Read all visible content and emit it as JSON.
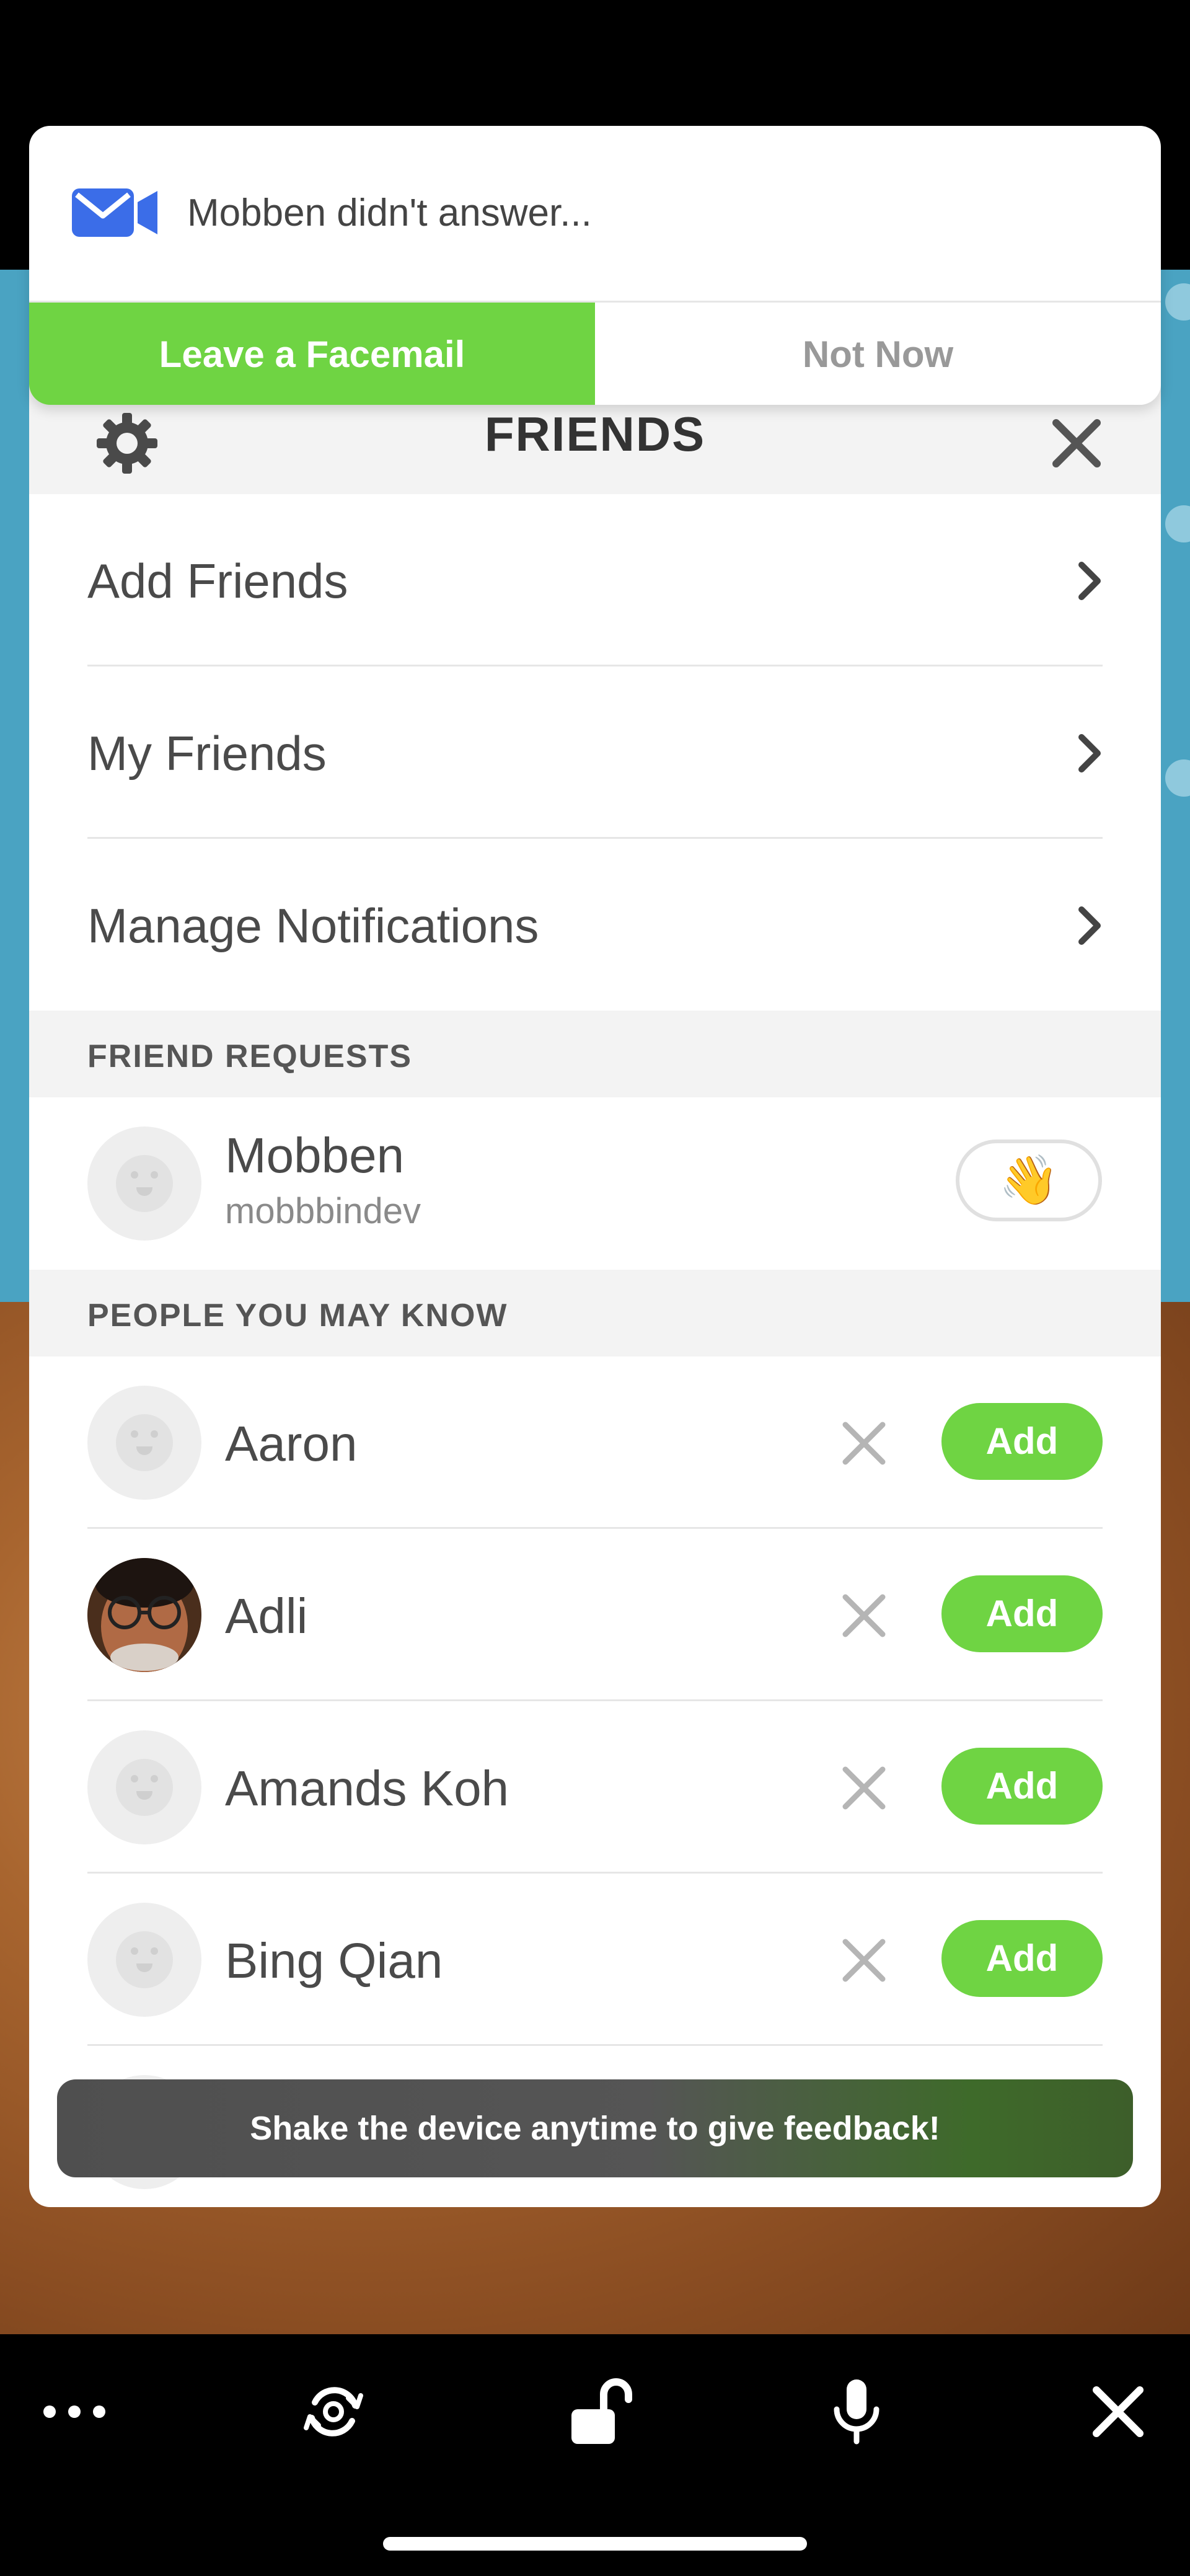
{
  "notification": {
    "message": "Mobben didn't answer...",
    "primary_label": "Leave a Facemail",
    "secondary_label": "Not Now"
  },
  "panel": {
    "title": "FRIENDS"
  },
  "menu": [
    {
      "label": "Add Friends"
    },
    {
      "label": "My Friends"
    },
    {
      "label": "Manage Notifications"
    }
  ],
  "friend_requests": {
    "header": "FRIEND REQUESTS",
    "items": [
      {
        "name": "Mobben",
        "username": "mobbbindev",
        "action": "👋"
      }
    ]
  },
  "people_you_may_know": {
    "header": "PEOPLE YOU MAY KNOW",
    "add_label": "Add",
    "items": [
      {
        "name": "Aaron",
        "avatar": "placeholder"
      },
      {
        "name": "Adli",
        "avatar": "photo"
      },
      {
        "name": "Amands Koh",
        "avatar": "placeholder"
      },
      {
        "name": "Bing Qian",
        "avatar": "placeholder"
      }
    ]
  },
  "toast": {
    "message": "Shake the device anytime to give feedback!"
  },
  "controls": {
    "icons": [
      "more-icon",
      "flip-camera-icon",
      "unlock-icon",
      "microphone-icon",
      "close-icon"
    ]
  },
  "colors": {
    "accent_green": "#6fd443",
    "envelope_blue": "#3b6de8",
    "background_blue": "#4aa3c2"
  }
}
